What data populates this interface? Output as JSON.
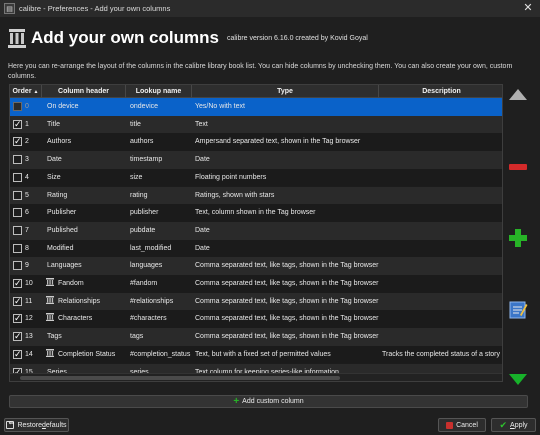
{
  "window": {
    "title": "calibre - Preferences - Add your own columns",
    "close_glyph": "✕"
  },
  "header": {
    "title": "Add your own columns",
    "version": "calibre version 6.16.0 created by Kovid Goyal",
    "icon": "pillars-icon"
  },
  "description": "Here you can re-arrange the layout of the columns in the calibre library book list. You can hide columns by unchecking them. You can also create your own, custom columns.",
  "table": {
    "columns": [
      "Order",
      "Column header",
      "Lookup name",
      "Type",
      "Description"
    ],
    "sort_indicator": "▲",
    "rows": [
      {
        "checked": false,
        "order": "0",
        "header": "On device",
        "lookup": "ondevice",
        "type": "Yes/No with text",
        "description": "",
        "custom": false,
        "selected": true,
        "disabled": true
      },
      {
        "checked": true,
        "order": "1",
        "header": "Title",
        "lookup": "title",
        "type": "Text",
        "description": "",
        "custom": false
      },
      {
        "checked": true,
        "order": "2",
        "header": "Authors",
        "lookup": "authors",
        "type": "Ampersand separated text, shown in the Tag browser",
        "description": "",
        "custom": false
      },
      {
        "checked": false,
        "order": "3",
        "header": "Date",
        "lookup": "timestamp",
        "type": "Date",
        "description": "",
        "custom": false
      },
      {
        "checked": false,
        "order": "4",
        "header": "Size",
        "lookup": "size",
        "type": "Floating point numbers",
        "description": "",
        "custom": false
      },
      {
        "checked": false,
        "order": "5",
        "header": "Rating",
        "lookup": "rating",
        "type": "Ratings, shown with stars",
        "description": "",
        "custom": false
      },
      {
        "checked": false,
        "order": "6",
        "header": "Publisher",
        "lookup": "publisher",
        "type": "Text, column shown in the Tag browser",
        "description": "",
        "custom": false
      },
      {
        "checked": false,
        "order": "7",
        "header": "Published",
        "lookup": "pubdate",
        "type": "Date",
        "description": "",
        "custom": false
      },
      {
        "checked": false,
        "order": "8",
        "header": "Modified",
        "lookup": "last_modified",
        "type": "Date",
        "description": "",
        "custom": false
      },
      {
        "checked": false,
        "order": "9",
        "header": "Languages",
        "lookup": "languages",
        "type": "Comma separated text, like tags, shown in the Tag browser",
        "description": "",
        "custom": false
      },
      {
        "checked": true,
        "order": "10",
        "header": "Fandom",
        "lookup": "#fandom",
        "type": "Comma separated text, like tags, shown in the Tag browser",
        "description": "",
        "custom": true
      },
      {
        "checked": true,
        "order": "11",
        "header": "Relationships",
        "lookup": "#relationships",
        "type": "Comma separated text, like tags, shown in the Tag browser",
        "description": "",
        "custom": true
      },
      {
        "checked": true,
        "order": "12",
        "header": "Characters",
        "lookup": "#characters",
        "type": "Comma separated text, like tags, shown in the Tag browser",
        "description": "",
        "custom": true
      },
      {
        "checked": true,
        "order": "13",
        "header": "Tags",
        "lookup": "tags",
        "type": "Comma separated text, like tags, shown in the Tag browser",
        "description": "",
        "custom": false
      },
      {
        "checked": true,
        "order": "14",
        "header": "Completion Status",
        "lookup": "#completion_status",
        "type": "Text, but with a fixed set of permitted values",
        "description": "Tracks the completed status of a story or s",
        "custom": true
      },
      {
        "checked": true,
        "order": "15",
        "header": "Series",
        "lookup": "series",
        "type": "Text column for keeping series-like information",
        "description": "",
        "custom": false
      }
    ]
  },
  "side_buttons": {
    "move_up": "move-up-icon",
    "remove": "remove-icon",
    "add": "add-icon",
    "edit": "edit-icon",
    "move_down": "move-down-icon"
  },
  "add_custom_column_label": "Add custom column",
  "footer": {
    "restore_prefix": "Restore ",
    "restore_underlined": "d",
    "restore_suffix": "efaults",
    "cancel": "Cancel",
    "apply_underlined": "A",
    "apply_suffix": "pply"
  },
  "colors": {
    "selection": "#0a62c9",
    "add_green": "#27b327",
    "remove_red": "#d42a2a",
    "move_gray": "#b0b0b0",
    "move_down_green": "#17b22a"
  }
}
